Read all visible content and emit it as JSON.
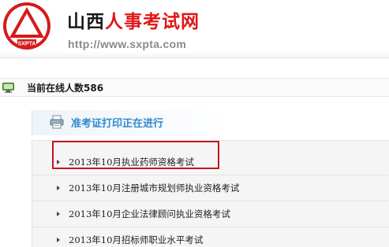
{
  "header": {
    "title_part1": "山西",
    "title_part2": "人事考试网",
    "url": "http://www.sxpta.com",
    "logo_text": "SXPTA",
    "colors": {
      "brand_red": "#e01616",
      "title_black": "#1a1a1a",
      "url_gray": "#8a8a8a"
    }
  },
  "online": {
    "text": "当前在线人数586",
    "icon": "monitor-icon"
  },
  "notice": {
    "text": "准考证打印正在进行",
    "icon": "printer-icon",
    "color": "#2e8bcf"
  },
  "exams": [
    {
      "label": "2013年10月执业药师资格考试",
      "highlighted": true
    },
    {
      "label": "2013年10月注册城市规划师执业资格考试"
    },
    {
      "label": "2013年10月企业法律顾问执业资格考试"
    },
    {
      "label": "2013年10月招标师职业水平考试"
    }
  ]
}
